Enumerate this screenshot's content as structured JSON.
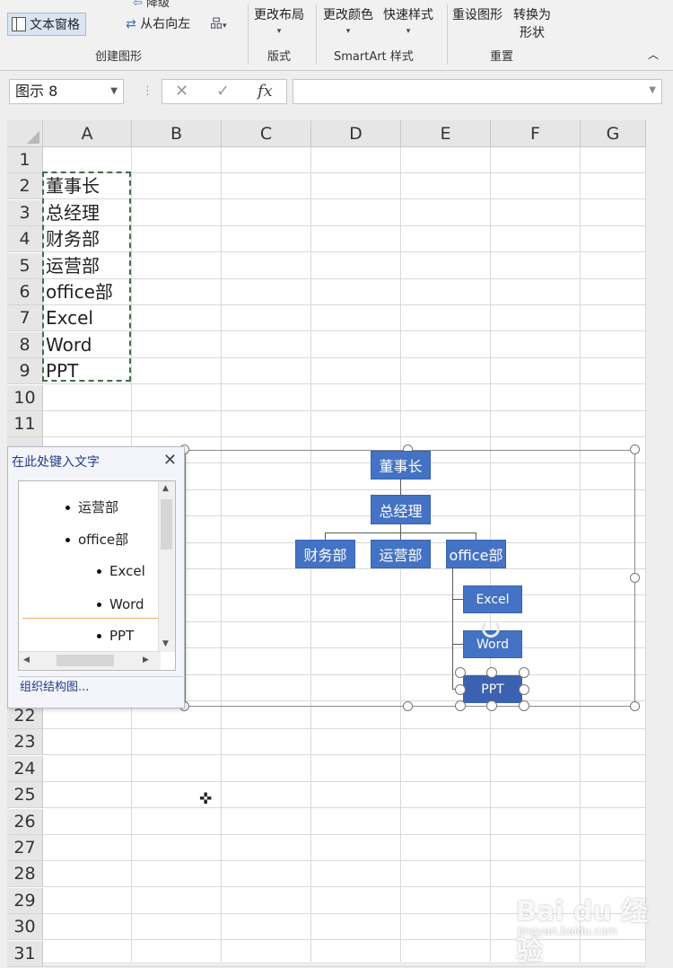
{
  "ribbon": {
    "text_pane": "文本窗格",
    "demote": "降级",
    "rtl": "从右向左",
    "change_layout": "更改布局",
    "change_colors": "更改颜色",
    "quick_styles": "快速样式",
    "reset_graphic": "重设图形",
    "convert_line1": "转换为",
    "convert_line2": "形状",
    "groups": {
      "create": "创建图形",
      "layouts": "版式",
      "styles": "SmartArt 样式",
      "reset": "重置"
    }
  },
  "formula_bar": {
    "name_box": "图示 8",
    "fx": "fx",
    "cancel": "✕",
    "enter": "✓",
    "value": ""
  },
  "columns": [
    "A",
    "B",
    "C",
    "D",
    "E",
    "F",
    "G"
  ],
  "rows_top": [
    "1",
    "2",
    "3",
    "4",
    "5",
    "6",
    "7",
    "8",
    "9",
    "10",
    "11"
  ],
  "rows_bottom": [
    "22",
    "23",
    "24",
    "25",
    "26",
    "27",
    "28",
    "29",
    "30",
    "31"
  ],
  "cells": [
    "董事长",
    "总经理",
    "财务部",
    "运营部",
    "office部",
    "Excel",
    "Word",
    "PPT"
  ],
  "text_pane": {
    "title": "在此处键入文字",
    "close": "✕",
    "items": [
      "运营部",
      "office部",
      "Excel",
      "Word",
      "PPT"
    ],
    "footer": "组织结构图..."
  },
  "org_chart": {
    "chairman": "董事长",
    "gm": "总经理",
    "finance": "财务部",
    "operations": "运营部",
    "office": "office部",
    "excel": "Excel",
    "word": "Word",
    "ppt": "PPT"
  },
  "watermark": {
    "brand": "Bai du 经验",
    "url": "jingyan.baidu.com"
  },
  "colors": {
    "smartart_fill": "#4472c4",
    "accent": "#1f3c88"
  }
}
